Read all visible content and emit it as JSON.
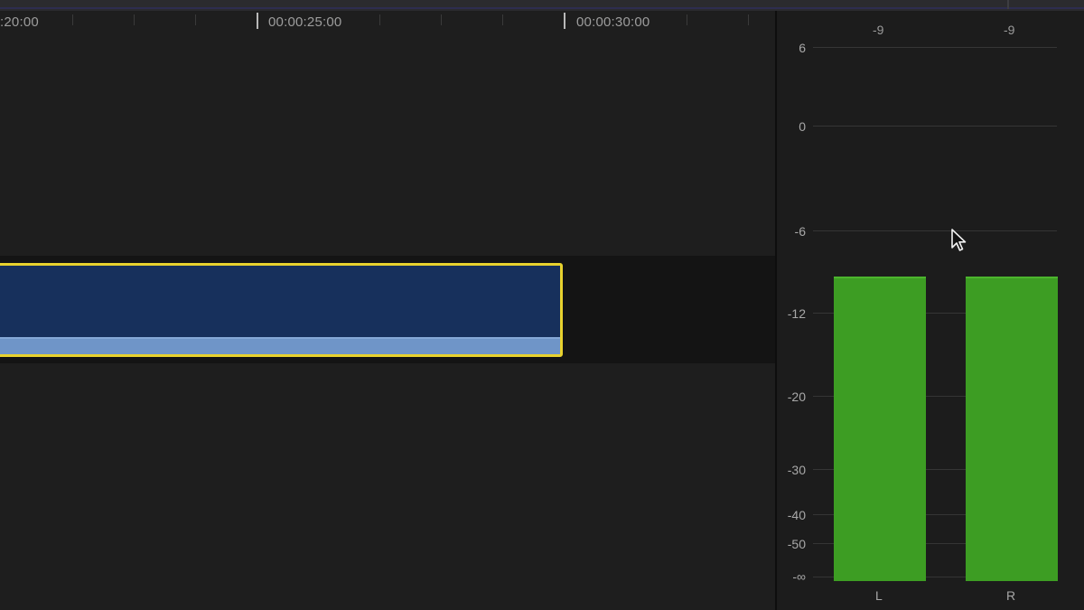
{
  "timeline": {
    "ruler_labels": [
      ":20:00",
      "00:00:25:00",
      "00:00:30:00"
    ],
    "clip": {
      "selected": true,
      "color": "#17305c",
      "outline_color": "#e8d22e",
      "audio_color": "#6f95c8"
    }
  },
  "audio_meter": {
    "peak_labels": {
      "left": "-9",
      "right": "-9"
    },
    "scale_labels": [
      "6",
      "0",
      "-6",
      "-12",
      "-20",
      "-30",
      "-40",
      "-50",
      "-∞"
    ],
    "channels": [
      {
        "label": "L",
        "level_db": -9
      },
      {
        "label": "R",
        "level_db": -9
      }
    ],
    "bar_color": "#3d9d23"
  }
}
